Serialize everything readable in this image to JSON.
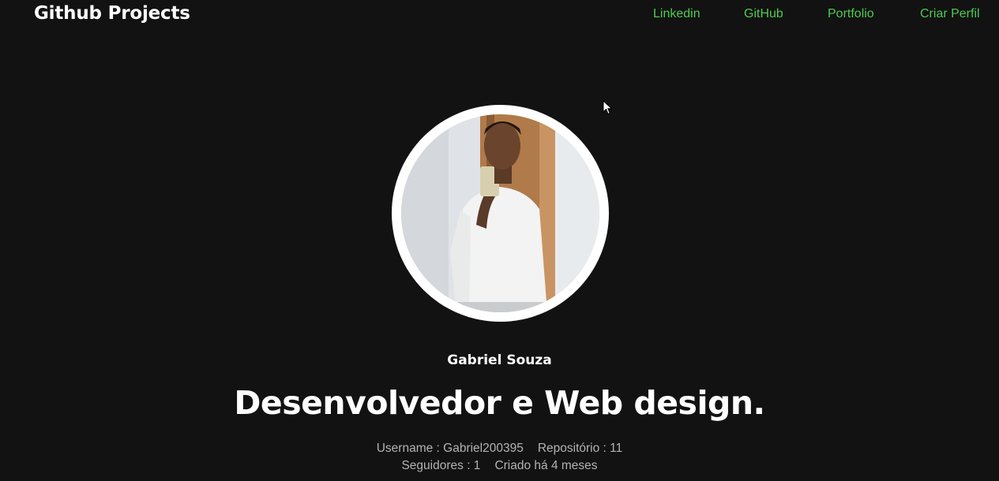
{
  "header": {
    "brand": "Github Projects",
    "nav": [
      {
        "label": "Linkedin"
      },
      {
        "label": "GitHub"
      },
      {
        "label": "Portfolio"
      },
      {
        "label": "Criar Perfil"
      }
    ]
  },
  "profile": {
    "name": "Gabriel Souza",
    "headline": "Desenvolvedor e Web design.",
    "username": "Username : Gabriel200395",
    "repositories": "Repositório : 11",
    "followers": "Seguidores : 1",
    "created": "Criado há 4 meses"
  },
  "colors": {
    "background": "#121212",
    "nav_link": "#4ecb4e",
    "text_primary": "#ffffff",
    "text_muted": "#b3b3b3"
  },
  "icons": {
    "cursor": "mouse-pointer-icon"
  }
}
